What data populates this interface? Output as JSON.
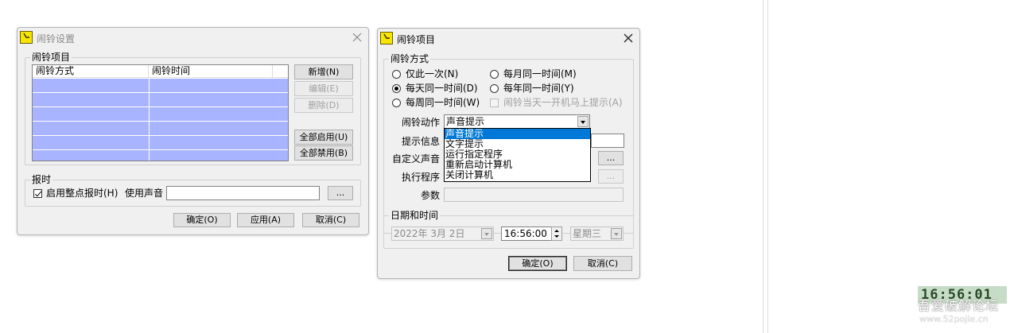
{
  "icons": {
    "app": "alarm-clock-icon",
    "close": "close-icon"
  },
  "colors": {
    "selection_row": "#a8b4ff",
    "dropdown_highlight": "#0078d7"
  },
  "dialog1": {
    "title": "闹铃设置",
    "group_items": "闹铃项目",
    "columns": [
      "闹铃方式",
      "闹铃时间"
    ],
    "buttons": {
      "add": "新增(N)",
      "edit": "编辑(E)",
      "delete": "删除(D)",
      "enable_all": "全部启用(U)",
      "disable_all": "全部禁用(B)"
    },
    "group_chime": "报时",
    "chime_checkbox": "启用整点报时(H)",
    "use_sound_label": "使用声音",
    "browse": "...",
    "ok": "确定(O)",
    "apply": "应用(A)",
    "cancel": "取消(C)"
  },
  "dialog2": {
    "title": "闹铃项目",
    "group_mode": "闹铃方式",
    "modes": {
      "once": "仅此一次(N)",
      "daily": "每天同一时间(D)",
      "weekly": "每周同一时间(W)",
      "monthly": "每月同一时间(M)",
      "yearly": "每年同一时间(Y)"
    },
    "startup_check": "闹铃当天一开机马上提示(A)",
    "action_label": "闹铃动作",
    "action_value": "声音提示",
    "action_options": [
      "声音提示",
      "文字提示",
      "运行指定程序",
      "重新启动计算机",
      "关闭计算机"
    ],
    "message_label": "提示信息",
    "sound_label": "自定义声音",
    "program_label": "执行程序",
    "params_label": "参数",
    "browse": "...",
    "group_datetime": "日期和时间",
    "date_value": "2022年  3月  2日",
    "time_value": "16:56:00",
    "weekday_value": "星期三",
    "ok": "确定(O)",
    "cancel": "取消(C)"
  },
  "watermark": {
    "clock": "16:56:01",
    "site": "吾爱破解论坛",
    "url": "www.52pojie.cn"
  }
}
